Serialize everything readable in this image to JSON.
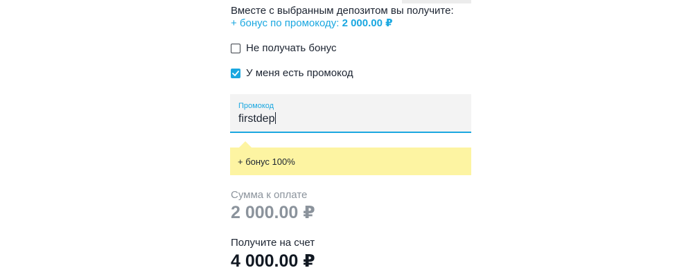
{
  "deposit": {
    "intro_text": "Вместе с выбранным депозитом вы получите:",
    "bonus_prefix": "+ бонус по промокоду:",
    "bonus_amount": "2 000.00 ₽"
  },
  "options": [
    {
      "label": "Не получать бонус",
      "checked": false
    },
    {
      "label": "У меня есть промокод",
      "checked": true
    }
  ],
  "promo": {
    "label": "Промокод",
    "value": "firstdep",
    "hint": "+ бонус 100%"
  },
  "summary": {
    "pay_label": "Сумма к оплате",
    "pay_amount": "2 000.00 ₽",
    "receive_label": "Получите на счет",
    "receive_amount": "4 000.00 ₽"
  },
  "colors": {
    "accent": "#1aa7e0",
    "hint_background": "#fdf4a2",
    "muted_text": "#8b939c",
    "input_background": "#f3f3f3"
  }
}
